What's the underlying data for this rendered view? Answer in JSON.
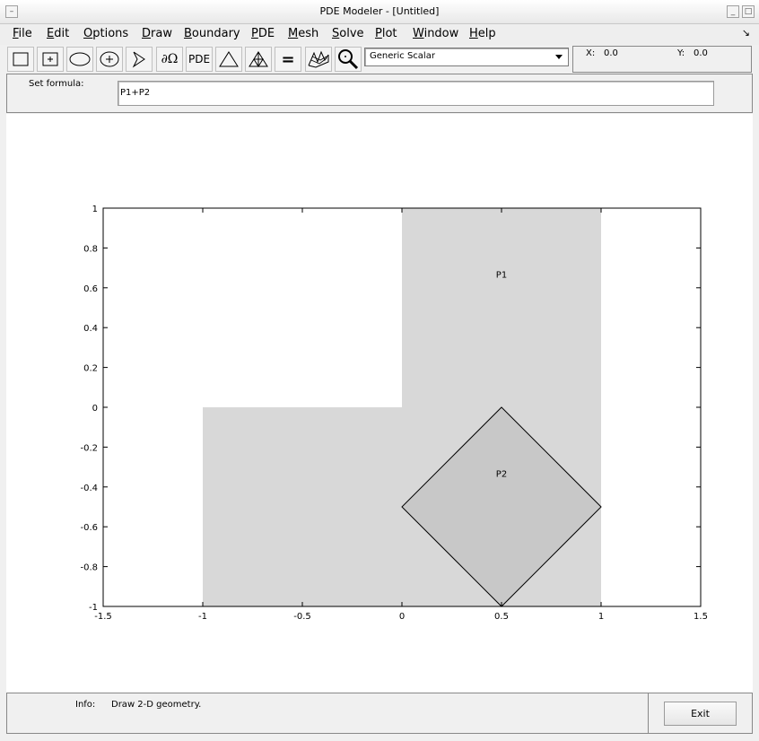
{
  "window": {
    "title": "PDE Modeler - [Untitled]"
  },
  "menu": [
    {
      "label": "File",
      "u": "F",
      "rest": "ile"
    },
    {
      "label": "Edit",
      "u": "E",
      "rest": "dit"
    },
    {
      "label": "Options",
      "u": "O",
      "rest": "ptions"
    },
    {
      "label": "Draw",
      "u": "D",
      "rest": "raw",
      "pre": ""
    },
    {
      "label": "Boundary",
      "u": "B",
      "rest": "oundary"
    },
    {
      "label": "PDE",
      "u": "P",
      "rest": "DE"
    },
    {
      "label": "Mesh",
      "u": "M",
      "rest": "esh"
    },
    {
      "label": "Solve",
      "u": "S",
      "rest": "olve"
    },
    {
      "label": "Plot",
      "u": "P",
      "rest": "lot"
    },
    {
      "label": "Window",
      "u": "W",
      "rest": "indow"
    },
    {
      "label": "Help",
      "u": "H",
      "rest": "elp"
    }
  ],
  "toolbar": {
    "buttons": [
      "rectangle-icon",
      "rectangle-center-icon",
      "ellipse-icon",
      "ellipse-center-icon",
      "polygon-icon",
      "boundary-omega-icon",
      "pde-icon",
      "triangle-mesh-icon",
      "refine-mesh-icon",
      "solve-equals-icon",
      "plot-3d-icon",
      "zoom-icon"
    ],
    "omega_label": "∂Ω",
    "pde_label": "PDE",
    "equals_label": "=",
    "mode": "Generic Scalar"
  },
  "coords": {
    "x_label": "X:",
    "x_value": "0.0",
    "y_label": "Y:",
    "y_value": "0.0"
  },
  "formula": {
    "label": "Set formula:",
    "value": "P1+P2"
  },
  "status": {
    "info_label": "Info:",
    "info_text": "Draw 2-D geometry.",
    "exit_label": "Exit"
  },
  "chart_data": {
    "type": "geometry",
    "xlim": [
      -1.5,
      1.5
    ],
    "ylim": [
      -1,
      1
    ],
    "xticks": [
      "-1.5",
      "-1",
      "-0.5",
      "0",
      "0.5",
      "1",
      "1.5"
    ],
    "yticks": [
      "1",
      "0.8",
      "0.6",
      "0.4",
      "0.2",
      "0",
      "-0.2",
      "-0.4",
      "-0.6",
      "-0.8",
      "-1"
    ],
    "shapes": [
      {
        "name": "P1",
        "label_at": [
          0.5,
          0.67
        ],
        "fill": "#d8d8d8",
        "points": [
          [
            -1,
            -1
          ],
          [
            1,
            -1
          ],
          [
            1,
            1
          ],
          [
            0,
            1
          ],
          [
            0,
            0
          ],
          [
            -1,
            0
          ]
        ]
      },
      {
        "name": "P2",
        "label_at": [
          0.5,
          -0.33
        ],
        "fill": "#c8c8c8",
        "points": [
          [
            0.5,
            0
          ],
          [
            1,
            -0.5
          ],
          [
            0.5,
            -1
          ],
          [
            0,
            -0.5
          ]
        ]
      }
    ]
  }
}
